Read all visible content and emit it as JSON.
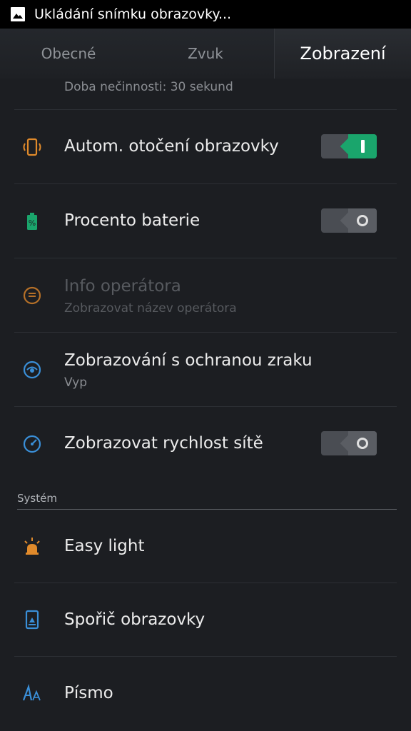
{
  "status_bar": {
    "text": "Ukládání snímku obrazovky..."
  },
  "tabs": [
    {
      "label": "Obecné"
    },
    {
      "label": "Zvuk"
    },
    {
      "label": "Zobrazení",
      "active": true
    }
  ],
  "settings": {
    "sleep": {
      "subtitle": "Doba nečinnosti: 30 sekund"
    },
    "auto_rotate": {
      "title": "Autom. otočení obrazovky",
      "on": true
    },
    "battery_percent": {
      "title": "Procento baterie",
      "on": false
    },
    "carrier_info": {
      "title": "Info operátora",
      "subtitle": "Zobrazovat název operátora",
      "enabled": false
    },
    "eye_protection": {
      "title": "Zobrazování s ochranou zraku",
      "subtitle": "Vyp"
    },
    "network_speed": {
      "title": "Zobrazovat rychlost sítě",
      "on": false
    }
  },
  "system_section": {
    "header": "Systém",
    "items": [
      {
        "title": "Easy light"
      },
      {
        "title": "Spořič obrazovky"
      },
      {
        "title": "Písmo"
      }
    ]
  },
  "colors": {
    "accent_green": "#1aa56c",
    "icon_orange": "#e08a2b",
    "icon_blue": "#3a8fd8",
    "icon_teal": "#1aa56c",
    "background": "#1c1e22"
  }
}
